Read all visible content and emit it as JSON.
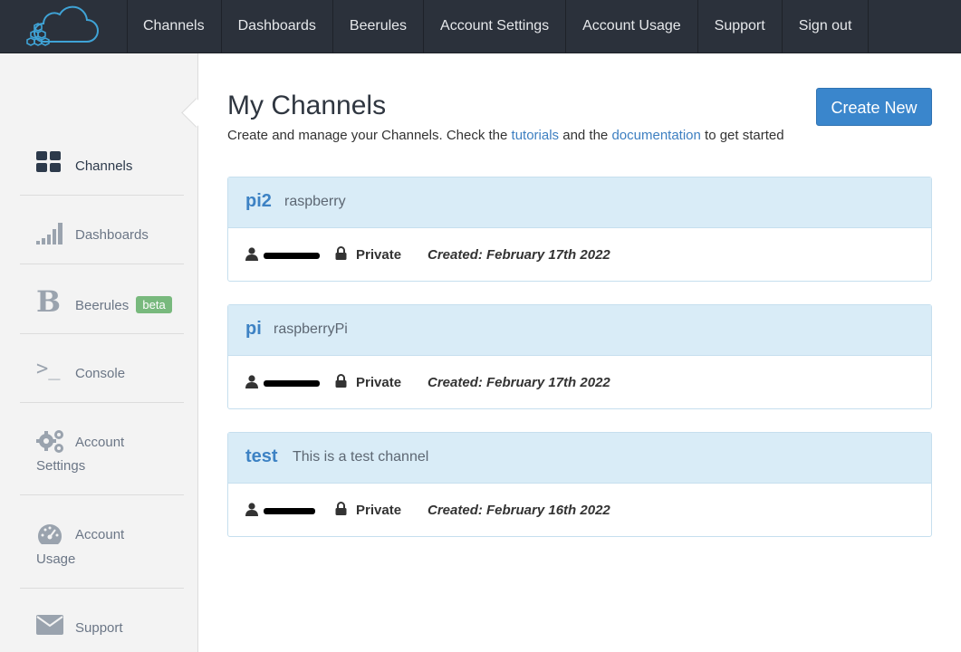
{
  "nav": {
    "items": [
      "Channels",
      "Dashboards",
      "Beerules",
      "Account Settings",
      "Account Usage",
      "Support",
      "Sign out"
    ]
  },
  "sidebar": {
    "channels": "Channels",
    "dashboards": "Dashboards",
    "beerules": "Beerules",
    "beerules_badge": "beta",
    "console": "Console",
    "console_glyph": ">_",
    "account_settings_1": "Account",
    "account_settings_2": "Settings",
    "account_usage_1": "Account",
    "account_usage_2": "Usage",
    "support": "Support"
  },
  "main": {
    "title": "My Channels",
    "subtitle_pre": "Create and manage your Channels. Check the ",
    "link_tutorials": "tutorials",
    "subtitle_mid": " and the ",
    "link_documentation": "documentation",
    "subtitle_post": " to get started",
    "create_button": "Create New"
  },
  "channels": [
    {
      "name": "pi2",
      "description": "raspberry",
      "privacy": "Private",
      "created": "Created: February 17th 2022"
    },
    {
      "name": "pi",
      "description": "raspberryPi",
      "privacy": "Private",
      "created": "Created: February 17th 2022"
    },
    {
      "name": "test",
      "description": "This is a test channel",
      "privacy": "Private",
      "created": "Created: February 16th 2022"
    }
  ],
  "colors": {
    "nav_bg": "#2b313b",
    "accent": "#3a86cc",
    "card_head": "#d9ecf7",
    "badge": "#78b97d"
  }
}
